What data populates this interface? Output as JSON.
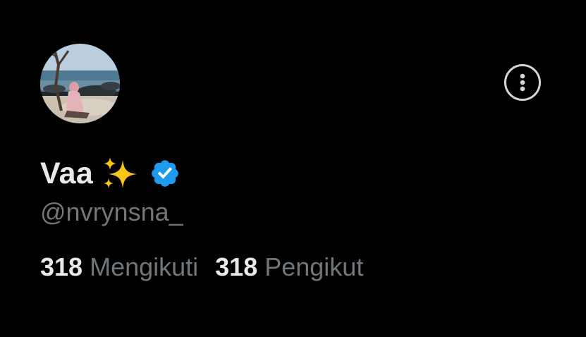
{
  "profile": {
    "display_name": "Vaa",
    "name_emoji": "✨",
    "verified": true,
    "handle": "@nvrynsna_",
    "stats": {
      "following_count": "318",
      "following_label": "Mengikuti",
      "followers_count": "318",
      "followers_label": "Pengikut"
    }
  },
  "colors": {
    "background": "#000000",
    "primary_text": "#e7e9ea",
    "secondary_text": "#71767b",
    "verified_badge": "#1d9bf0",
    "sparkle": "#f5c518"
  },
  "icons": {
    "more": "more-options-icon",
    "verified": "verified-badge-icon",
    "sparkles": "sparkles-icon"
  }
}
